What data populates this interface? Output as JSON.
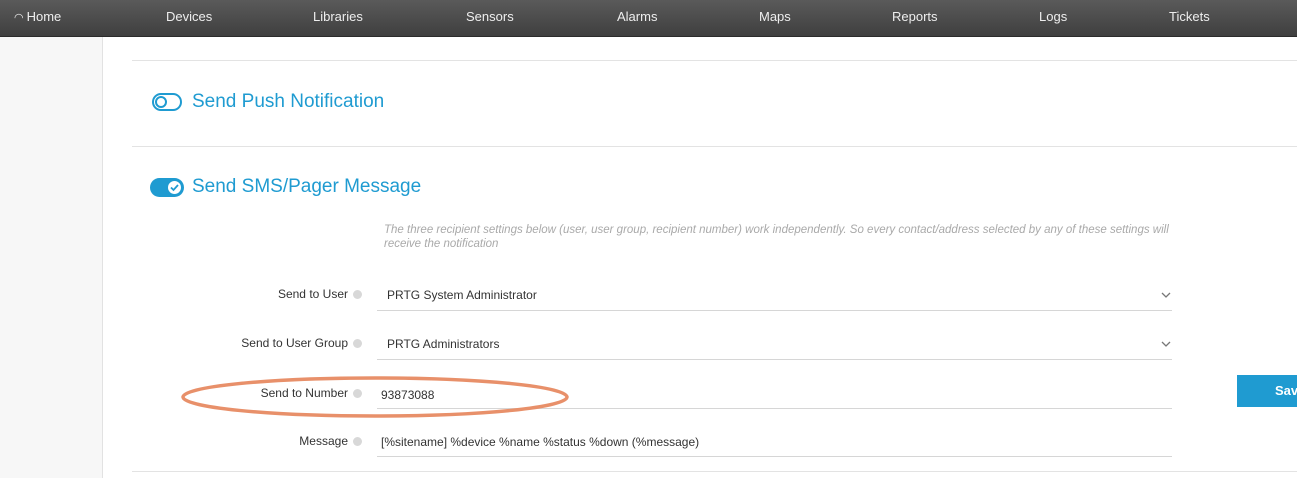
{
  "nav": {
    "home": "Home",
    "items": [
      "Devices",
      "Libraries",
      "Sensors",
      "Alarms",
      "Maps",
      "Reports",
      "Logs",
      "Tickets"
    ]
  },
  "push": {
    "title": "Send Push Notification"
  },
  "sms": {
    "title": "Send SMS/Pager Message",
    "info": "The three recipient settings below (user, user group, recipient number) work independently. So every contact/address selected by any of these settings will receive the notification",
    "fields": [
      {
        "label": "Send to User",
        "value": "PRTG System Administrator"
      },
      {
        "label": "Send to User Group",
        "value": "PRTG Administrators"
      },
      {
        "label": "Send to Number",
        "value": "93873088"
      },
      {
        "label": "Message",
        "value": "[%sitename] %device %name %status %down (%message)"
      }
    ]
  },
  "save_label": "Sav",
  "colors": {
    "accent": "#1f9bd1",
    "highlight": "#e8906a",
    "nav_bg": "#4a4a4a"
  }
}
